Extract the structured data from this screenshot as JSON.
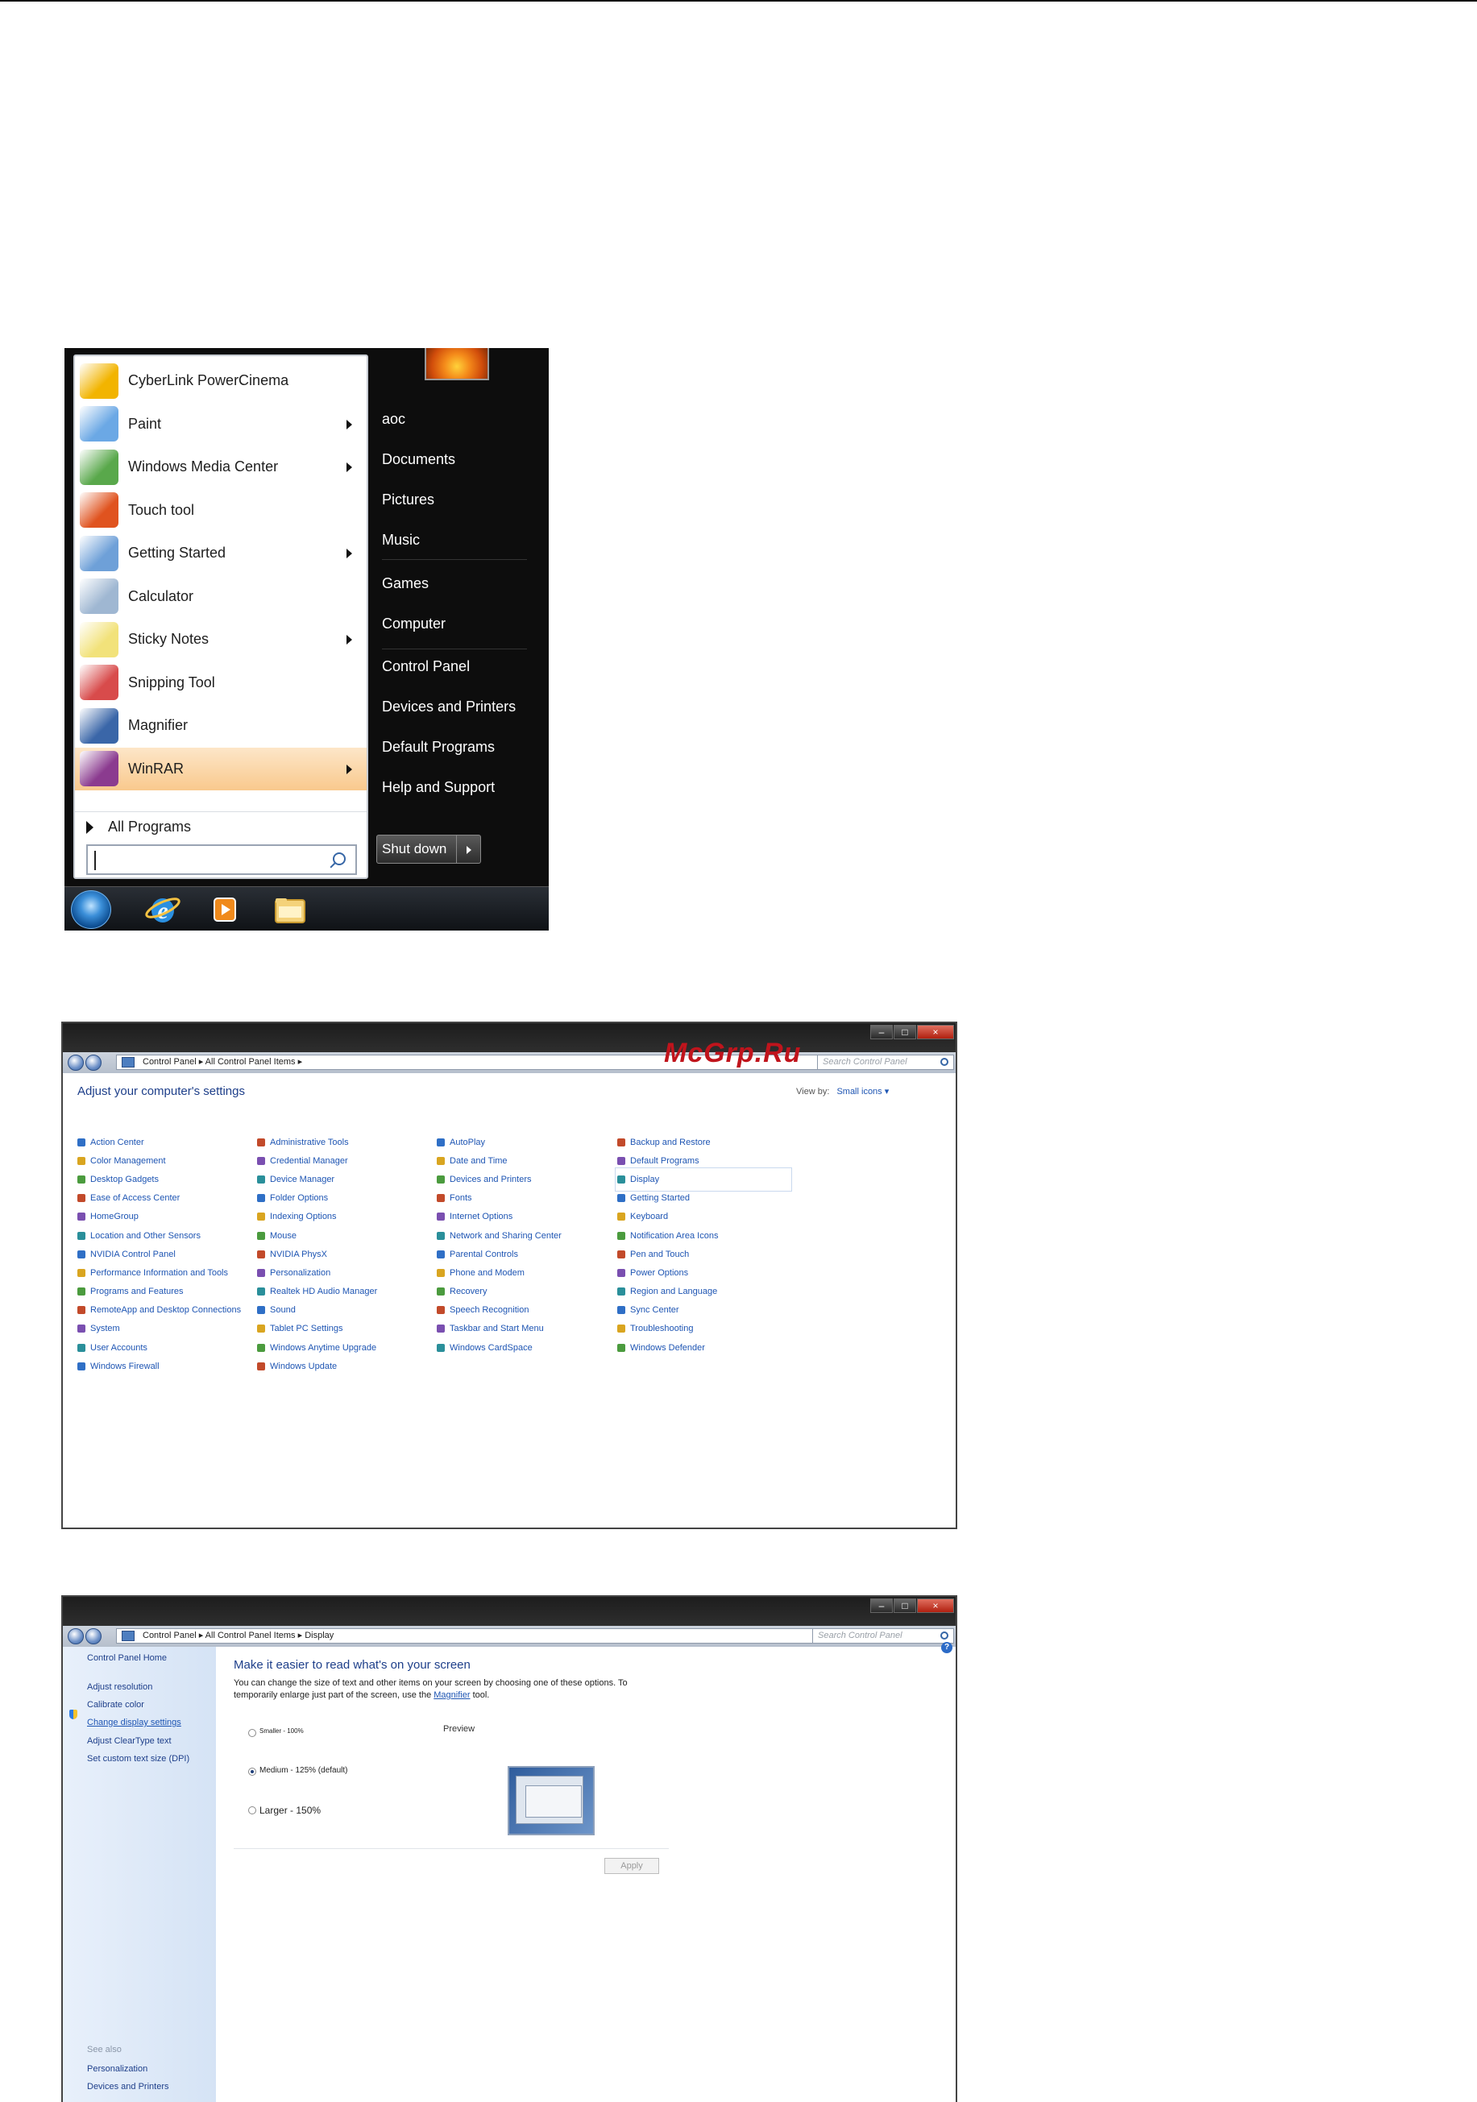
{
  "start_menu": {
    "programs": [
      {
        "label": "CyberLink PowerCinema",
        "icon": "cyberlink-icon",
        "arrow": false,
        "highlighted": false
      },
      {
        "label": "Paint",
        "icon": "paint-icon",
        "arrow": true,
        "highlighted": false
      },
      {
        "label": "Windows Media Center",
        "icon": "media-center-icon",
        "arrow": true,
        "highlighted": false
      },
      {
        "label": "Touch tool",
        "icon": "touch-tool-icon",
        "arrow": false,
        "highlighted": false
      },
      {
        "label": "Getting Started",
        "icon": "getting-started-icon",
        "arrow": true,
        "highlighted": false
      },
      {
        "label": "Calculator",
        "icon": "calculator-icon",
        "arrow": false,
        "highlighted": false
      },
      {
        "label": "Sticky Notes",
        "icon": "sticky-notes-icon",
        "arrow": true,
        "highlighted": false
      },
      {
        "label": "Snipping Tool",
        "icon": "snipping-tool-icon",
        "arrow": false,
        "highlighted": false
      },
      {
        "label": "Magnifier",
        "icon": "magnifier-icon",
        "arrow": false,
        "highlighted": false
      },
      {
        "label": "WinRAR",
        "icon": "winrar-icon",
        "arrow": true,
        "highlighted": true
      }
    ],
    "all_programs": "All Programs",
    "search_value": "",
    "right_items": [
      {
        "label": "aoc"
      },
      {
        "label": "Documents"
      },
      {
        "label": "Pictures"
      },
      {
        "label": "Music"
      },
      {
        "label": "Games"
      },
      {
        "label": "Computer"
      },
      {
        "label": "Control Panel"
      },
      {
        "label": "Devices and Printers"
      },
      {
        "label": "Default Programs"
      },
      {
        "label": "Help and Support"
      }
    ],
    "shutdown_label": "Shut down"
  },
  "control_panel": {
    "breadcrumb": "Control Panel  ▸  All Control Panel Items  ▸",
    "search_placeholder": "Search Control Panel",
    "watermark": "McGrp.Ru",
    "heading": "Adjust your computer's settings",
    "view_by_label": "View by:",
    "view_by_value": "Small icons ▾",
    "columns": [
      [
        "Action Center",
        "Color Management",
        "Desktop Gadgets",
        "Ease of Access Center",
        "HomeGroup",
        "Location and Other Sensors",
        "NVIDIA Control Panel",
        "Performance Information and Tools",
        "Programs and Features",
        "RemoteApp and Desktop Connections",
        "System",
        "User Accounts",
        "Windows Firewall"
      ],
      [
        "Administrative Tools",
        "Credential Manager",
        "Device Manager",
        "Folder Options",
        "Indexing Options",
        "Mouse",
        "NVIDIA PhysX",
        "Personalization",
        "Realtek HD Audio Manager",
        "Sound",
        "Tablet PC Settings",
        "Windows Anytime Upgrade",
        "Windows Update"
      ],
      [
        "AutoPlay",
        "Date and Time",
        "Devices and Printers",
        "Fonts",
        "Internet Options",
        "Network and Sharing Center",
        "Parental Controls",
        "Phone and Modem",
        "Recovery",
        "Speech Recognition",
        "Taskbar and Start Menu",
        "Windows CardSpace"
      ],
      [
        "Backup and Restore",
        "Default Programs",
        "Display",
        "Getting Started",
        "Keyboard",
        "Notification Area Icons",
        "Pen and Touch",
        "Power Options",
        "Region and Language",
        "Sync Center",
        "Troubleshooting",
        "Windows Defender"
      ]
    ],
    "selected_item": "Display"
  },
  "display_window": {
    "breadcrumb": "Control Panel  ▸  All Control Panel Items  ▸  Display",
    "search_placeholder": "Search Control Panel",
    "sidebar": {
      "home": "Control Panel Home",
      "links": [
        "Adjust resolution",
        "Calibrate color",
        "Change display settings",
        "Adjust ClearType text",
        "Set custom text size (DPI)"
      ],
      "current": "Change display settings",
      "see_also": "See also",
      "see_also_links": [
        "Personalization",
        "Devices and Printers"
      ]
    },
    "title": "Make it easier to read what's on your screen",
    "description_1": "You can change the size of text and other items on your screen by choosing one of these options. To temporarily enlarge just part of the screen, use the",
    "description_link": "Magnifier",
    "description_2": "tool.",
    "options": [
      {
        "label": "Smaller - 100%",
        "selected": false
      },
      {
        "label": "Medium - 125% (default)",
        "selected": true
      },
      {
        "label": "Larger - 150%",
        "selected": false
      }
    ],
    "preview_label": "Preview",
    "apply_label": "Apply"
  }
}
